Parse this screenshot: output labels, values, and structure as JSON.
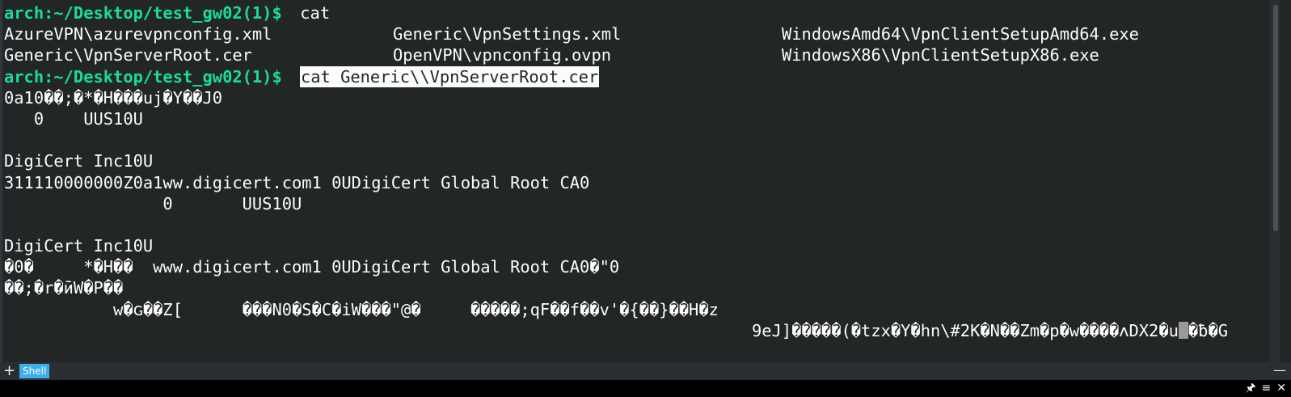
{
  "terminal": {
    "prompt": "arch:~/Desktop/test_gw02(1)$",
    "command1": " cat",
    "ls_out": {
      "c1r1": "AzureVPN\\azurevpnconfig.xml",
      "c2r1": "Generic\\VpnSettings.xml",
      "c3r1": "WindowsAmd64\\VpnClientSetupAmd64.exe",
      "c1r2": "Generic\\VpnServerRoot.cer",
      "c2r2": "OpenVPN\\vpnconfig.ovpn",
      "c3r2": "WindowsX86\\VpnClientSetupX86.exe"
    },
    "command2": "cat Generic\\\\VpnServerRoot.cer",
    "out": [
      "0a10��;�*�H���uj�Y��J0",
      "   0    UUS10U",
      "",
      "DigiCert Inc10U",
      "311110000000Z0a1ww.digicert.com1 0UDigiCert Global Root CA0",
      "                0       UUS10U",
      "",
      "DigiCert Inc10U",
      "�0�     *�H��  www.digicert.com1 0UDigiCert Global Root CA0�\"0",
      "��;�r�ӣW�P��",
      "           w�ɢ��Z[      ���N0�S�C�iW���\"@�     �����;qF��f��v'�{��}��H�z"
    ],
    "out_last": "9eJ]�����(�tzx�Y�hn\\#2K�N��Zm�p�w����ʌDX2�u",
    "out_last_tail": "�ƀ�G"
  },
  "tabs": {
    "new_tab": "+",
    "shell_label": "Shell",
    "menu_icon": "—"
  },
  "bottom": {
    "pin": "🖈",
    "menu": "≡",
    "close": "✕"
  }
}
